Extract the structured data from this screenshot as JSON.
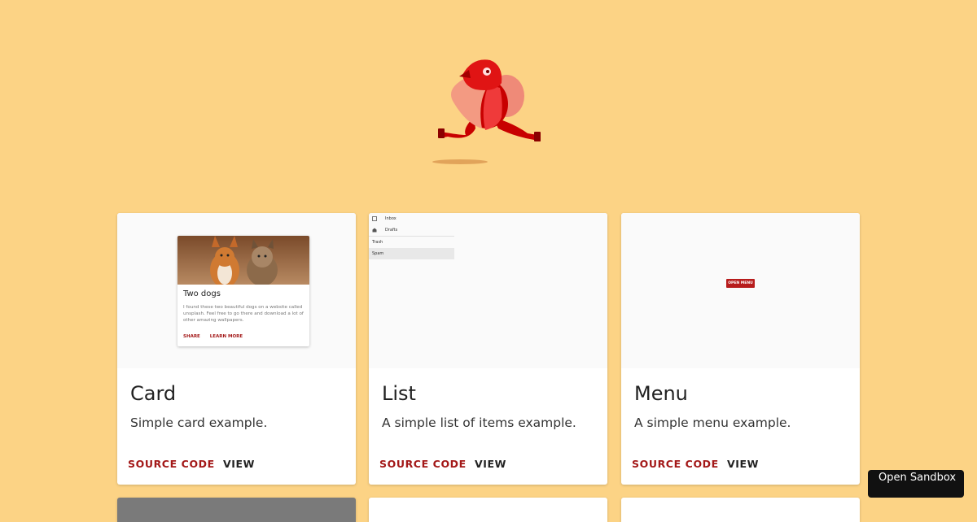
{
  "cards": [
    {
      "title": "Card",
      "description": "Simple card example.",
      "source_label": "SOURCE CODE",
      "view_label": "VIEW",
      "preview": {
        "title": "Two dogs",
        "text": "I found these two beautiful dogs on a website called unsplash. Feel free to go there and download a lot of other amazing wallpapers.",
        "actions": [
          "SHARE",
          "LEARN MORE"
        ]
      }
    },
    {
      "title": "List",
      "description": "A simple list of items example.",
      "source_label": "SOURCE CODE",
      "view_label": "VIEW",
      "preview": {
        "items": [
          "Inbox",
          "Drafts",
          "Trash",
          "Spam"
        ]
      }
    },
    {
      "title": "Menu",
      "description": "A simple menu example.",
      "source_label": "SOURCE CODE",
      "view_label": "VIEW",
      "preview": {
        "button_label": "OPEN MENU"
      }
    }
  ],
  "sandbox_button": {
    "label": "Open Sandbox"
  },
  "colors": {
    "background": "#fcd385",
    "accent": "#a31818",
    "mascot": "#d50000"
  },
  "icons": {
    "mascot": "running-character-illustration",
    "inbox": "inbox-icon",
    "drafts": "drafts-icon"
  }
}
